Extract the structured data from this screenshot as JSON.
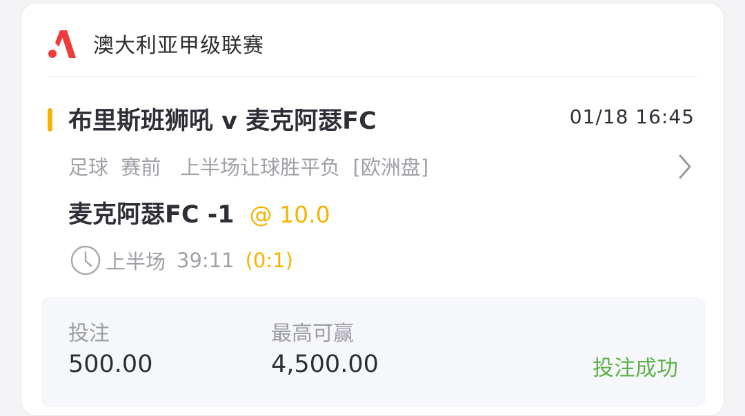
{
  "league": {
    "logo_icon": "a-shape-logo-icon",
    "name": "澳大利亚甲级联赛"
  },
  "match": {
    "title": "布里斯班狮吼 v 麦克阿瑟FC",
    "time": "01/18 16:45",
    "meta": "足球  赛前   上半场让球胜平负  [欧洲盘]",
    "accent_color": "#f4b400"
  },
  "selection": {
    "name": "麦克阿瑟FC -1",
    "odds": "@ 10.0"
  },
  "live": {
    "period": "上半场",
    "clock": "39:11",
    "score": "(0:1)"
  },
  "summary": {
    "stake_label": "投注",
    "stake_value": "500.00",
    "maxwin_label": "最高可赢",
    "maxwin_value": "4,500.00",
    "status": "投注成功",
    "status_color": "#5fb14b"
  },
  "icons": {
    "chevron": "chevron-right-icon",
    "clock": "clock-icon"
  }
}
